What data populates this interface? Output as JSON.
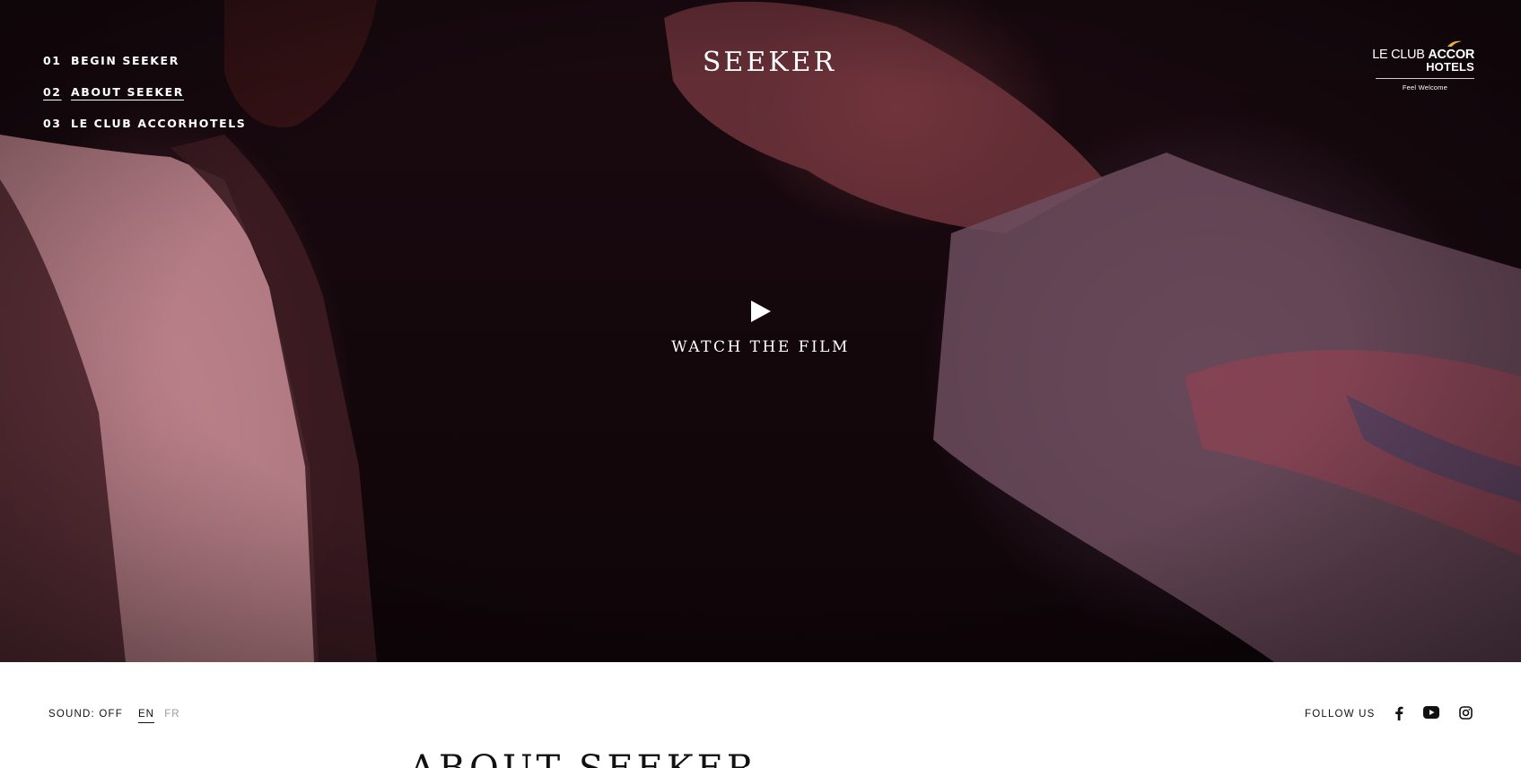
{
  "app": {
    "brand": "SEEKER"
  },
  "nav": {
    "items": [
      {
        "num": "01",
        "label": "BEGIN SEEKER",
        "active": false
      },
      {
        "num": "02",
        "label": "ABOUT SEEKER",
        "active": true
      },
      {
        "num": "03",
        "label": "LE CLUB ACCORHOTELS",
        "active": false
      }
    ]
  },
  "partner_logo": {
    "line1_thin": "LE CLUB",
    "line1_bold": "ACCOR",
    "line2": "HOTELS",
    "tagline": "Feel Welcome",
    "accent": "#e8b33a"
  },
  "hero": {
    "play_label": "WATCH THE FILM"
  },
  "footer": {
    "sound": "SOUND: OFF",
    "languages": [
      {
        "code": "EN",
        "active": true
      },
      {
        "code": "FR",
        "active": false
      }
    ],
    "follow_label": "FOLLOW US",
    "social_icons": [
      "facebook-icon",
      "youtube-icon",
      "instagram-icon"
    ]
  },
  "section": {
    "title": "ABOUT SEEKER"
  },
  "colors": {
    "text_dark": "#111111",
    "text_muted": "#9a9a9a"
  }
}
